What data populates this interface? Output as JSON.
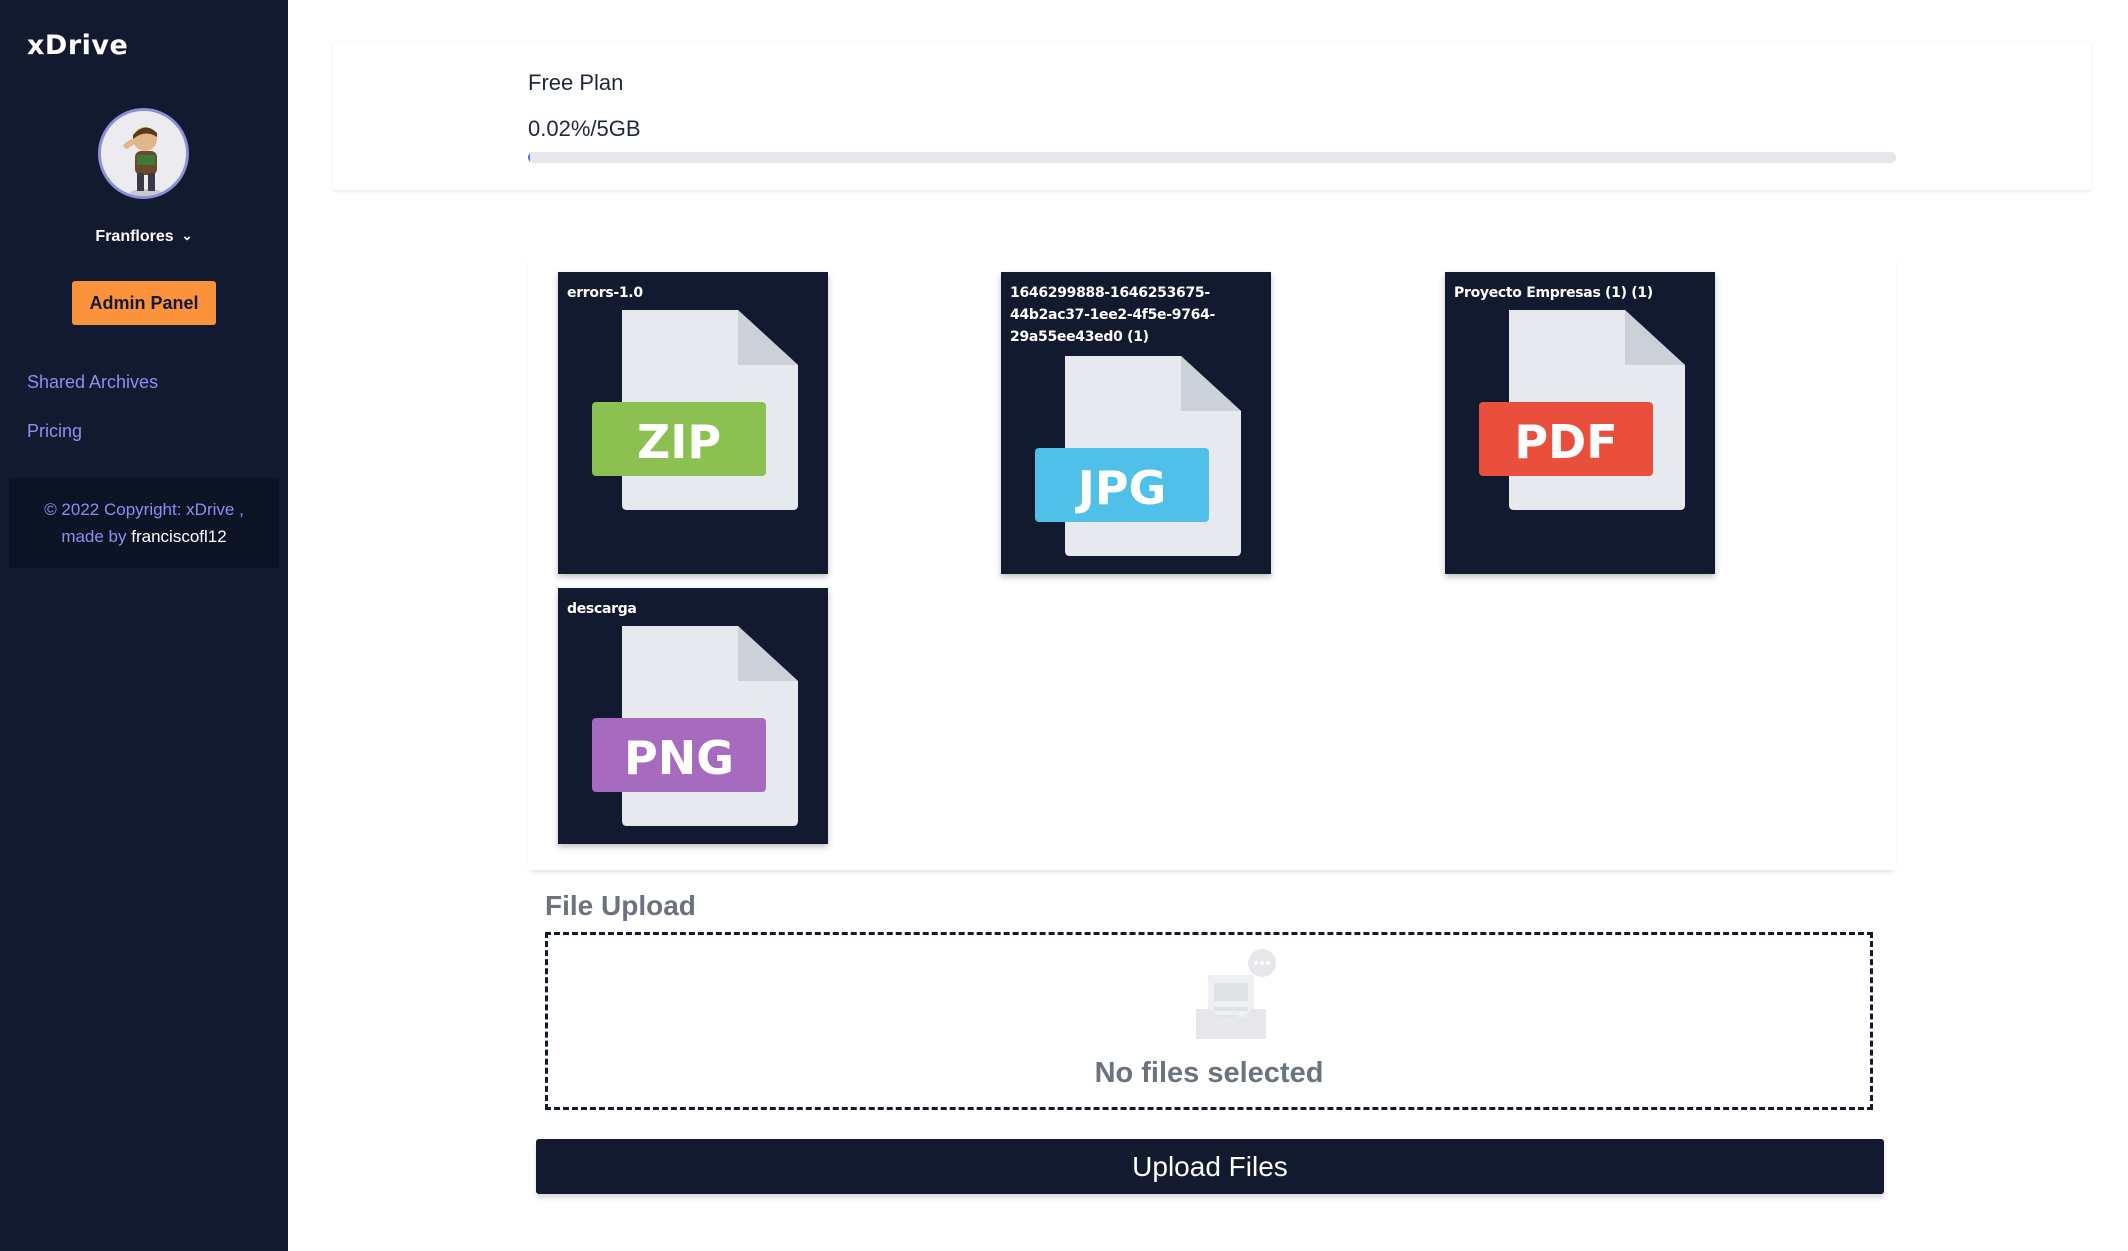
{
  "app": {
    "brand": "xDrive"
  },
  "sidebar": {
    "username": "Franflores",
    "admin_button": "Admin Panel",
    "nav": [
      {
        "label": "Shared Archives"
      },
      {
        "label": "Pricing"
      }
    ],
    "footer": {
      "copyright": "© 2022 Copyright: xDrive ,",
      "made_by": "made by",
      "author": "franciscofl12"
    }
  },
  "plan": {
    "title": "Free Plan",
    "usage_text": "0.02%/5GB",
    "usage_percent": 0.02
  },
  "files": [
    {
      "name": "errors-1.0",
      "type": "ZIP",
      "color": "#8cc152"
    },
    {
      "name": "1646299888-1646253675-44b2ac37-1ee2-4f5e-9764-29a55ee43ed0 (1)",
      "type": "JPG",
      "color": "#4fc1e9"
    },
    {
      "name": "Proyecto Empresas (1) (1)",
      "type": "PDF",
      "color": "#ea4e3d"
    },
    {
      "name": "descarga",
      "type": "PNG",
      "color": "#a66bbe"
    }
  ],
  "upload": {
    "title": "File Upload",
    "empty_text": "No files selected",
    "button_label": "Upload Files"
  }
}
